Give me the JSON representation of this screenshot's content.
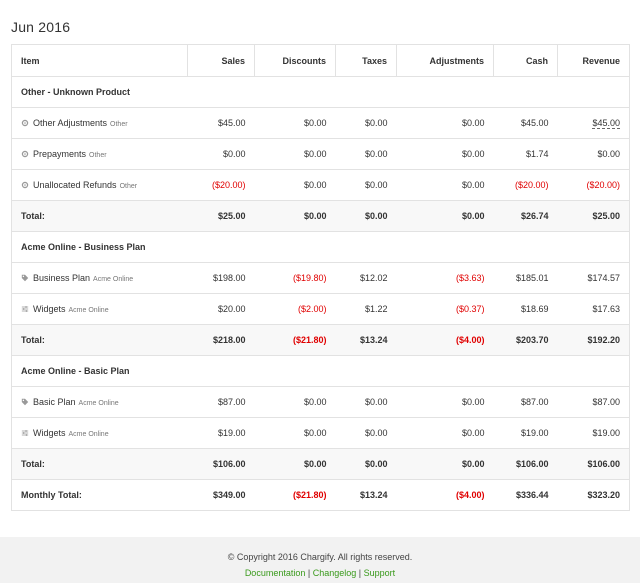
{
  "period": "Jun 2016",
  "columns": [
    "Item",
    "Sales",
    "Discounts",
    "Taxes",
    "Adjustments",
    "Cash",
    "Revenue"
  ],
  "sections": [
    {
      "title": "Other - Unknown Product",
      "rows": [
        {
          "icon": "gear-icon",
          "name": "Other Adjustments",
          "sub": "Other",
          "sales": "$45.00",
          "discounts": "$0.00",
          "taxes": "$0.00",
          "adjustments": "$0.00",
          "cash": "$45.00",
          "revenue": "$45.00"
        },
        {
          "icon": "gear-icon",
          "name": "Prepayments",
          "sub": "Other",
          "sales": "$0.00",
          "discounts": "$0.00",
          "taxes": "$0.00",
          "adjustments": "$0.00",
          "cash": "$1.74",
          "revenue": "$0.00"
        },
        {
          "icon": "gear-icon",
          "name": "Unallocated Refunds",
          "sub": "Other",
          "sales": "($20.00)",
          "discounts": "$0.00",
          "taxes": "$0.00",
          "adjustments": "$0.00",
          "cash": "($20.00)",
          "revenue": "($20.00)"
        }
      ],
      "total": {
        "label": "Total:",
        "sales": "$25.00",
        "discounts": "$0.00",
        "taxes": "$0.00",
        "adjustments": "$0.00",
        "cash": "$26.74",
        "revenue": "$25.00"
      }
    },
    {
      "title": "Acme Online - Business Plan",
      "rows": [
        {
          "icon": "tag-icon",
          "name": "Business Plan",
          "sub": "Acme Online",
          "sales": "$198.00",
          "discounts": "($19.80)",
          "taxes": "$12.02",
          "adjustments": "($3.63)",
          "cash": "$185.01",
          "revenue": "$174.57"
        },
        {
          "icon": "sliders-icon",
          "name": "Widgets",
          "sub": "Acme Online",
          "sales": "$20.00",
          "discounts": "($2.00)",
          "taxes": "$1.22",
          "adjustments": "($0.37)",
          "cash": "$18.69",
          "revenue": "$17.63"
        }
      ],
      "total": {
        "label": "Total:",
        "sales": "$218.00",
        "discounts": "($21.80)",
        "taxes": "$13.24",
        "adjustments": "($4.00)",
        "cash": "$203.70",
        "revenue": "$192.20"
      }
    },
    {
      "title": "Acme Online - Basic Plan",
      "rows": [
        {
          "icon": "tag-icon",
          "name": "Basic Plan",
          "sub": "Acme Online",
          "sales": "$87.00",
          "discounts": "$0.00",
          "taxes": "$0.00",
          "adjustments": "$0.00",
          "cash": "$87.00",
          "revenue": "$87.00"
        },
        {
          "icon": "sliders-icon",
          "name": "Widgets",
          "sub": "Acme Online",
          "sales": "$19.00",
          "discounts": "$0.00",
          "taxes": "$0.00",
          "adjustments": "$0.00",
          "cash": "$19.00",
          "revenue": "$19.00"
        }
      ],
      "total": {
        "label": "Total:",
        "sales": "$106.00",
        "discounts": "$0.00",
        "taxes": "$0.00",
        "adjustments": "$0.00",
        "cash": "$106.00",
        "revenue": "$106.00"
      }
    }
  ],
  "monthly_total": {
    "label": "Monthly Total:",
    "sales": "$349.00",
    "discounts": "($21.80)",
    "taxes": "$13.24",
    "adjustments": "($4.00)",
    "cash": "$336.44",
    "revenue": "$323.20"
  },
  "footer": {
    "copyright": "© Copyright 2016 Chargify. All rights reserved.",
    "links": [
      "Documentation",
      "Changelog",
      "Support"
    ],
    "separator": "|"
  },
  "colors": {
    "negative": "#e00000",
    "link": "#3a9a1c",
    "footer_bg": "#f2f2f2"
  }
}
